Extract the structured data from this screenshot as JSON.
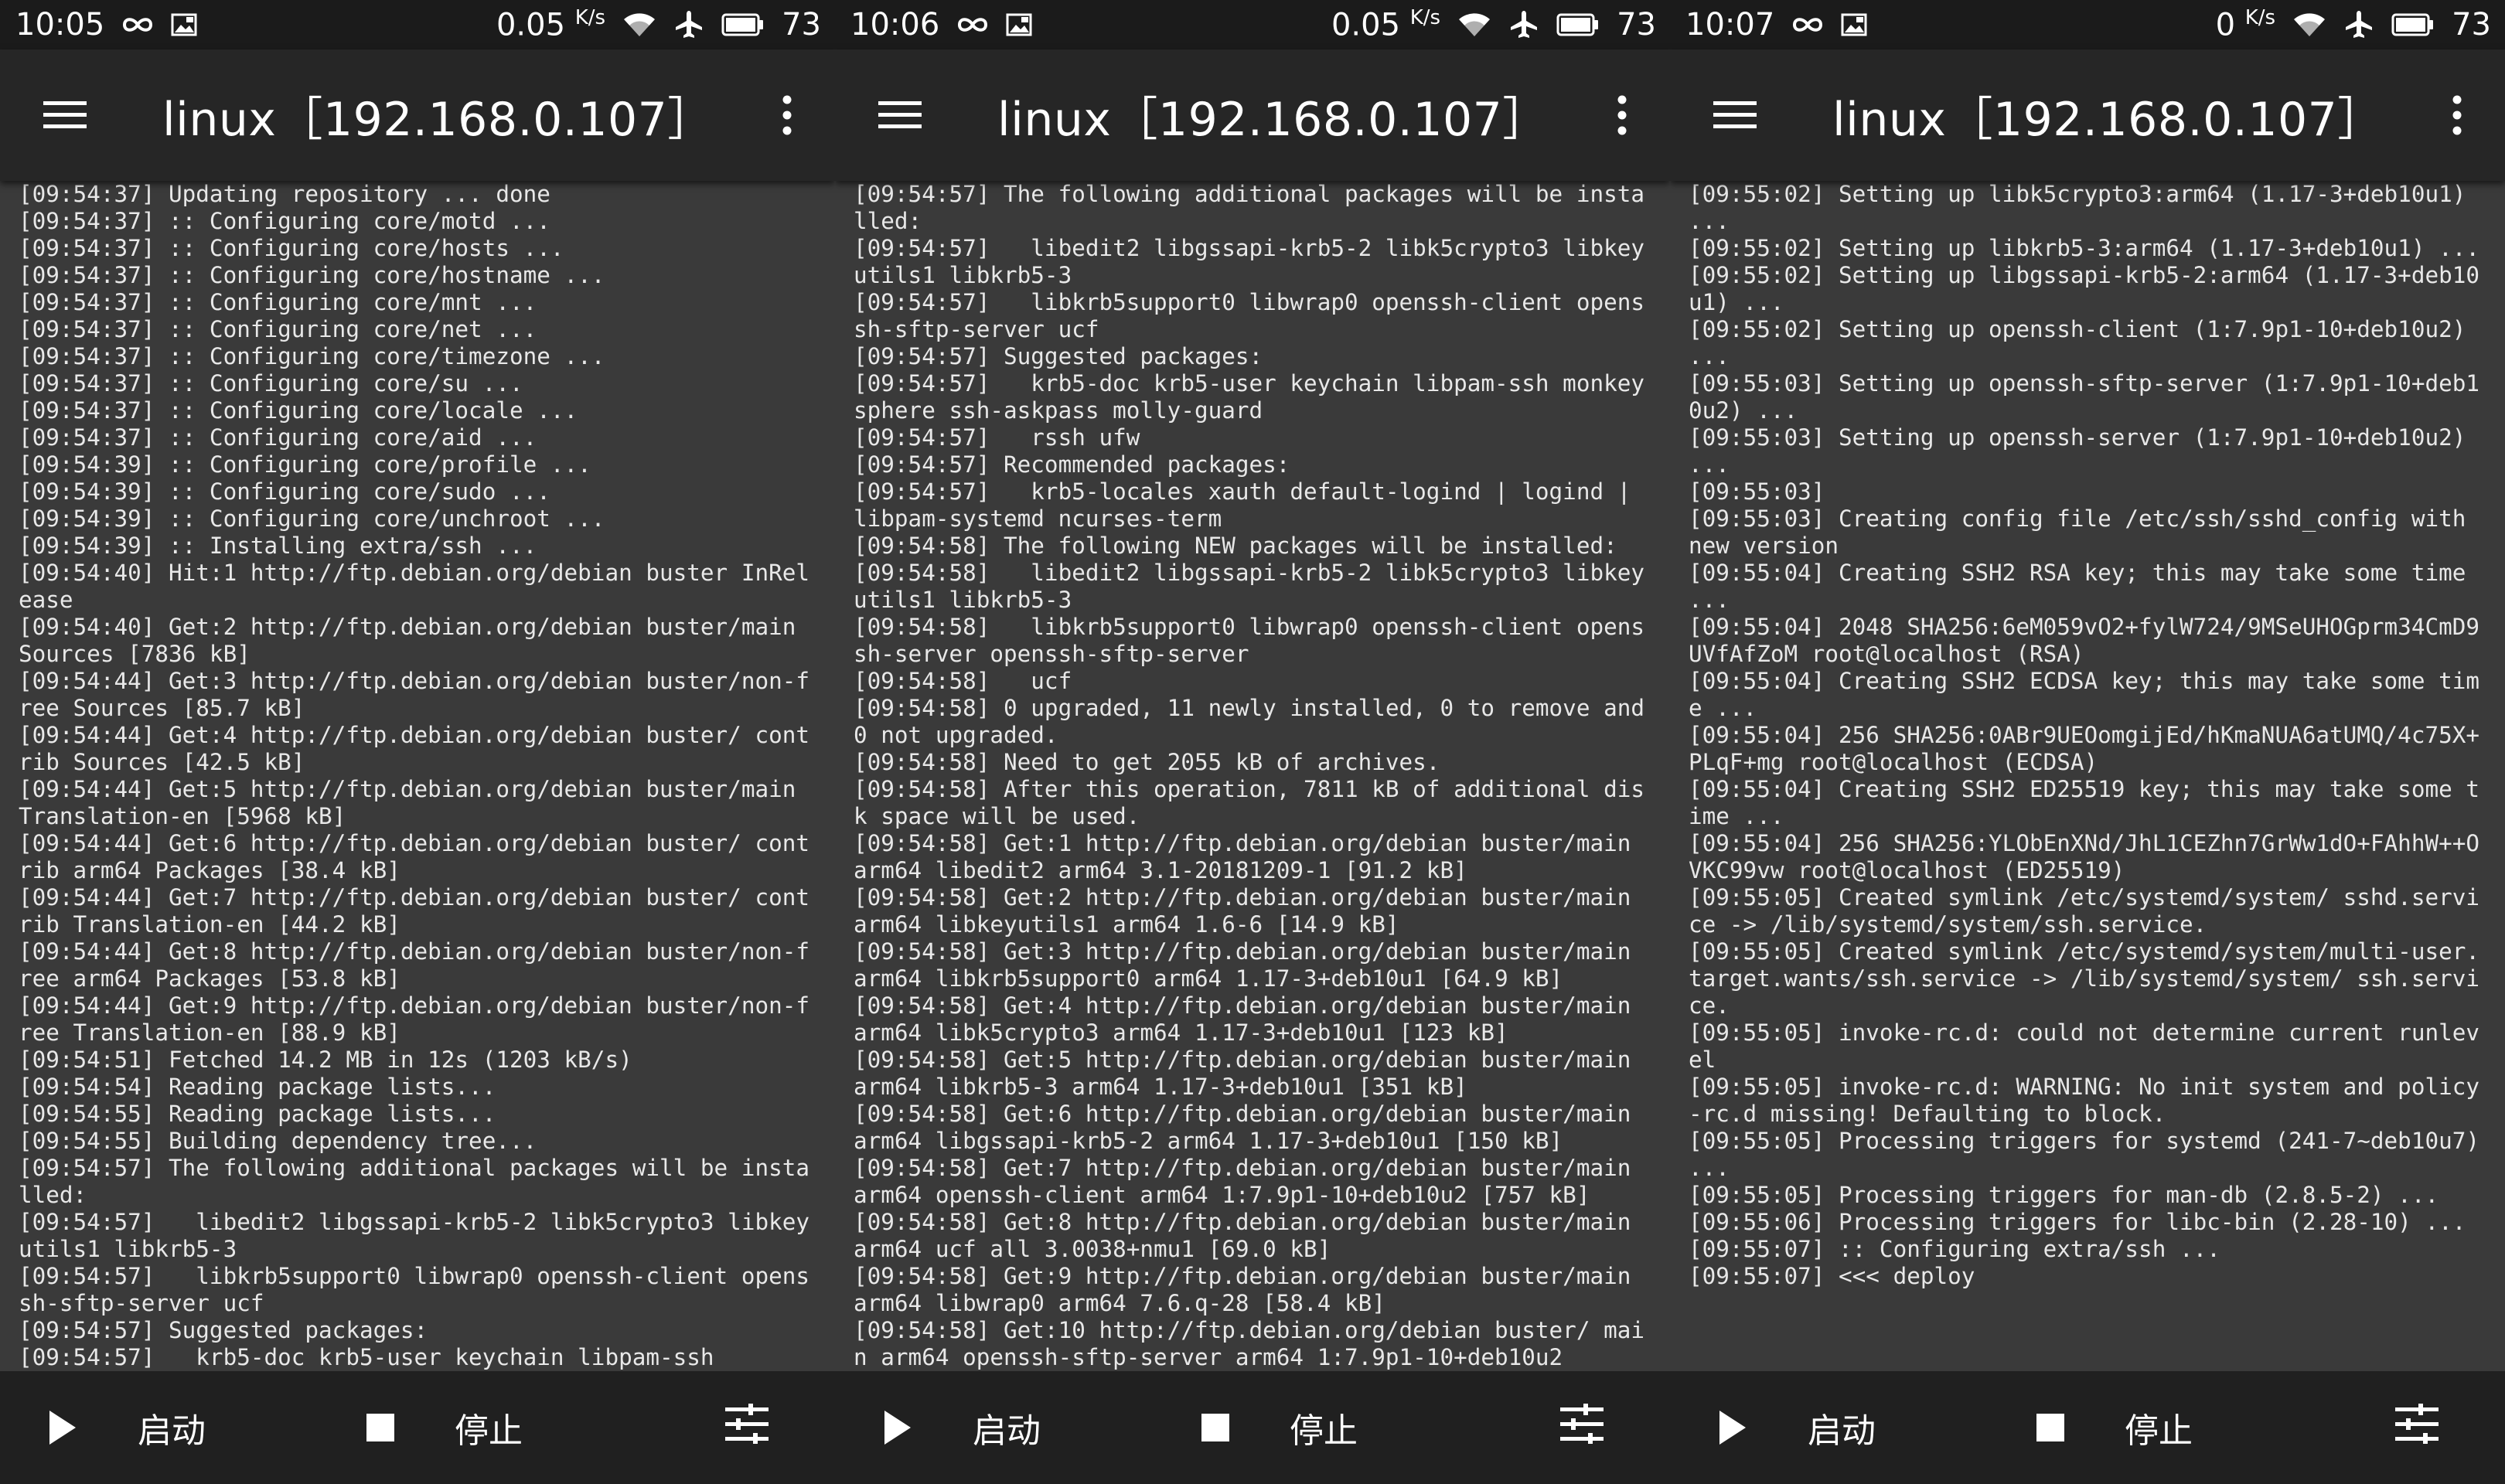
{
  "screens": [
    {
      "status": {
        "time": "10:05",
        "speed": "0.05",
        "speed_unit": "K/s",
        "battery": "73"
      },
      "title": "linux［192.168.0.107］",
      "log": [
        "[09:54:37] Updating repository ... done",
        "[09:54:37] :: Configuring core/motd ...",
        "[09:54:37] :: Configuring core/hosts ...",
        "[09:54:37] :: Configuring core/hostname ...",
        "[09:54:37] :: Configuring core/mnt ...",
        "[09:54:37] :: Configuring core/net ...",
        "[09:54:37] :: Configuring core/timezone ...",
        "[09:54:37] :: Configuring core/su ...",
        "[09:54:37] :: Configuring core/locale ...",
        "[09:54:37] :: Configuring core/aid ...",
        "[09:54:39] :: Configuring core/profile ...",
        "[09:54:39] :: Configuring core/sudo ...",
        "[09:54:39] :: Configuring core/unchroot ...",
        "[09:54:39] :: Installing extra/ssh ...",
        "[09:54:40] Hit:1 http://ftp.debian.org/debian buster InRelease",
        "[09:54:40] Get:2 http://ftp.debian.org/debian buster/main Sources [7836 kB]",
        "[09:54:44] Get:3 http://ftp.debian.org/debian buster/non-free Sources [85.7 kB]",
        "[09:54:44] Get:4 http://ftp.debian.org/debian buster/ contrib Sources [42.5 kB]",
        "[09:54:44] Get:5 http://ftp.debian.org/debian buster/main Translation-en [5968 kB]",
        "[09:54:44] Get:6 http://ftp.debian.org/debian buster/ contrib arm64 Packages [38.4 kB]",
        "[09:54:44] Get:7 http://ftp.debian.org/debian buster/ contrib Translation-en [44.2 kB]",
        "[09:54:44] Get:8 http://ftp.debian.org/debian buster/non-free arm64 Packages [53.8 kB]",
        "[09:54:44] Get:9 http://ftp.debian.org/debian buster/non-free Translation-en [88.9 kB]",
        "[09:54:51] Fetched 14.2 MB in 12s (1203 kB/s)",
        "[09:54:54] Reading package lists...",
        "[09:54:55] Reading package lists...",
        "[09:54:55] Building dependency tree...",
        "[09:54:57] The following additional packages will be installed:",
        "[09:54:57]   libedit2 libgssapi-krb5-2 libk5crypto3 libkeyutils1 libkrb5-3",
        "[09:54:57]   libkrb5support0 libwrap0 openssh-client openssh-sftp-server ucf",
        "[09:54:57] Suggested packages:",
        "[09:54:57]   krb5-doc krb5-user keychain libpam-ssh"
      ],
      "buttons": {
        "start": "启动",
        "stop": "停止"
      }
    },
    {
      "status": {
        "time": "10:06",
        "speed": "0.05",
        "speed_unit": "K/s",
        "battery": "73"
      },
      "title": "linux［192.168.0.107］",
      "log": [
        "[09:54:57] The following additional packages will be installed:",
        "[09:54:57]   libedit2 libgssapi-krb5-2 libk5crypto3 libkeyutils1 libkrb5-3",
        "[09:54:57]   libkrb5support0 libwrap0 openssh-client openssh-sftp-server ucf",
        "[09:54:57] Suggested packages:",
        "[09:54:57]   krb5-doc krb5-user keychain libpam-ssh monkeysphere ssh-askpass molly-guard",
        "[09:54:57]   rssh ufw",
        "[09:54:57] Recommended packages:",
        "[09:54:57]   krb5-locales xauth default-logind | logind | libpam-systemd ncurses-term",
        "[09:54:58] The following NEW packages will be installed:",
        "[09:54:58]   libedit2 libgssapi-krb5-2 libk5crypto3 libkeyutils1 libkrb5-3",
        "[09:54:58]   libkrb5support0 libwrap0 openssh-client openssh-server openssh-sftp-server",
        "[09:54:58]   ucf",
        "[09:54:58] 0 upgraded, 11 newly installed, 0 to remove and 0 not upgraded.",
        "[09:54:58] Need to get 2055 kB of archives.",
        "[09:54:58] After this operation, 7811 kB of additional disk space will be used.",
        "[09:54:58] Get:1 http://ftp.debian.org/debian buster/main arm64 libedit2 arm64 3.1-20181209-1 [91.2 kB]",
        "[09:54:58] Get:2 http://ftp.debian.org/debian buster/main arm64 libkeyutils1 arm64 1.6-6 [14.9 kB]",
        "[09:54:58] Get:3 http://ftp.debian.org/debian buster/main arm64 libkrb5support0 arm64 1.17-3+deb10u1 [64.9 kB]",
        "[09:54:58] Get:4 http://ftp.debian.org/debian buster/main arm64 libk5crypto3 arm64 1.17-3+deb10u1 [123 kB]",
        "[09:54:58] Get:5 http://ftp.debian.org/debian buster/main arm64 libkrb5-3 arm64 1.17-3+deb10u1 [351 kB]",
        "[09:54:58] Get:6 http://ftp.debian.org/debian buster/main arm64 libgssapi-krb5-2 arm64 1.17-3+deb10u1 [150 kB]",
        "[09:54:58] Get:7 http://ftp.debian.org/debian buster/main arm64 openssh-client arm64 1:7.9p1-10+deb10u2 [757 kB]",
        "[09:54:58] Get:8 http://ftp.debian.org/debian buster/main arm64 ucf all 3.0038+nmu1 [69.0 kB]",
        "[09:54:58] Get:9 http://ftp.debian.org/debian buster/main arm64 libwrap0 arm64 7.6.q-28 [58.4 kB]",
        "[09:54:58] Get:10 http://ftp.debian.org/debian buster/ main arm64 openssh-sftp-server arm64 1:7.9p1-10+deb10u2"
      ],
      "buttons": {
        "start": "启动",
        "stop": "停止"
      }
    },
    {
      "status": {
        "time": "10:07",
        "speed": "0",
        "speed_unit": "K/s",
        "battery": "73"
      },
      "title": "linux［192.168.0.107］",
      "log": [
        "[09:55:02] Setting up libk5crypto3:arm64 (1.17-3+deb10u1) ...",
        "[09:55:02] Setting up libkrb5-3:arm64 (1.17-3+deb10u1) ...",
        "[09:55:02] Setting up libgssapi-krb5-2:arm64 (1.17-3+deb10u1) ...",
        "[09:55:02] Setting up openssh-client (1:7.9p1-10+deb10u2) ...",
        "[09:55:03] Setting up openssh-sftp-server (1:7.9p1-10+deb10u2) ...",
        "[09:55:03] Setting up openssh-server (1:7.9p1-10+deb10u2) ...",
        "[09:55:03]",
        "[09:55:03] Creating config file /etc/ssh/sshd_config with new version",
        "[09:55:04] Creating SSH2 RSA key; this may take some time ...",
        "[09:55:04] 2048 SHA256:6eM059vO2+fylW724/9MSeUHOGprm34CmD9UVfAfZoM root@localhost (RSA)",
        "[09:55:04] Creating SSH2 ECDSA key; this may take some time ...",
        "[09:55:04] 256 SHA256:0ABr9UEOomgijEd/hKmaNUA6atUMQ/4c75X+PLqF+mg root@localhost (ECDSA)",
        "[09:55:04] Creating SSH2 ED25519 key; this may take some time ...",
        "[09:55:04] 256 SHA256:YLObEnXNd/JhL1CEZhn7GrWw1dO+FAhhW++OVKC99vw root@localhost (ED25519)",
        "[09:55:05] Created symlink /etc/systemd/system/ sshd.service -> /lib/systemd/system/ssh.service.",
        "[09:55:05] Created symlink /etc/systemd/system/multi-user.target.wants/ssh.service -> /lib/systemd/system/ ssh.service.",
        "[09:55:05] invoke-rc.d: could not determine current runlevel",
        "[09:55:05] invoke-rc.d: WARNING: No init system and policy-rc.d missing! Defaulting to block.",
        "[09:55:05] Processing triggers for systemd (241-7~deb10u7) ...",
        "[09:55:05] Processing triggers for man-db (2.8.5-2) ...",
        "[09:55:06] Processing triggers for libc-bin (2.28-10) ...",
        "[09:55:07] :: Configuring extra/ssh ...",
        "[09:55:07] <<< deploy"
      ],
      "buttons": {
        "start": "启动",
        "stop": "停止"
      }
    }
  ]
}
